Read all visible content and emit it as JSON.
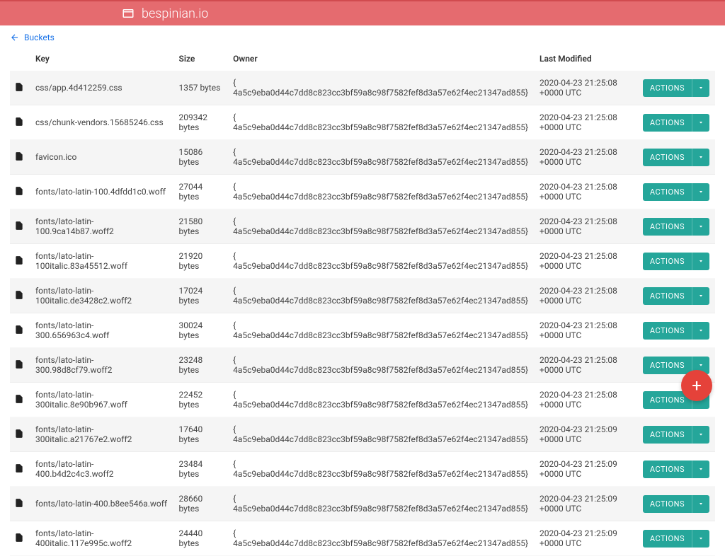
{
  "header": {
    "title": "bespinian.io"
  },
  "breadcrumb": {
    "label": "Buckets"
  },
  "columns": {
    "key": "Key",
    "size": "Size",
    "owner": "Owner",
    "modified": "Last Modified"
  },
  "actions_label": "ACTIONS",
  "rows": [
    {
      "key": "css/app.4d412259.css",
      "size": "1357 bytes",
      "owner": "{ 4a5c9eba0d44c7dd8c823cc3bf59a8c98f7582fef8d3a57e62f4ec21347ad855}",
      "modified": "2020-04-23 21:25:08 +0000 UTC"
    },
    {
      "key": "css/chunk-vendors.15685246.css",
      "size": "209342 bytes",
      "owner": "{ 4a5c9eba0d44c7dd8c823cc3bf59a8c98f7582fef8d3a57e62f4ec21347ad855}",
      "modified": "2020-04-23 21:25:08 +0000 UTC"
    },
    {
      "key": "favicon.ico",
      "size": "15086 bytes",
      "owner": "{ 4a5c9eba0d44c7dd8c823cc3bf59a8c98f7582fef8d3a57e62f4ec21347ad855}",
      "modified": "2020-04-23 21:25:08 +0000 UTC"
    },
    {
      "key": "fonts/lato-latin-100.4dfdd1c0.woff",
      "size": "27044 bytes",
      "owner": "{ 4a5c9eba0d44c7dd8c823cc3bf59a8c98f7582fef8d3a57e62f4ec21347ad855}",
      "modified": "2020-04-23 21:25:08 +0000 UTC"
    },
    {
      "key": "fonts/lato-latin-100.9ca14b87.woff2",
      "size": "21580 bytes",
      "owner": "{ 4a5c9eba0d44c7dd8c823cc3bf59a8c98f7582fef8d3a57e62f4ec21347ad855}",
      "modified": "2020-04-23 21:25:08 +0000 UTC"
    },
    {
      "key": "fonts/lato-latin-100italic.83a45512.woff",
      "size": "21920 bytes",
      "owner": "{ 4a5c9eba0d44c7dd8c823cc3bf59a8c98f7582fef8d3a57e62f4ec21347ad855}",
      "modified": "2020-04-23 21:25:08 +0000 UTC"
    },
    {
      "key": "fonts/lato-latin-100italic.de3428c2.woff2",
      "size": "17024 bytes",
      "owner": "{ 4a5c9eba0d44c7dd8c823cc3bf59a8c98f7582fef8d3a57e62f4ec21347ad855}",
      "modified": "2020-04-23 21:25:08 +0000 UTC"
    },
    {
      "key": "fonts/lato-latin-300.656963c4.woff",
      "size": "30024 bytes",
      "owner": "{ 4a5c9eba0d44c7dd8c823cc3bf59a8c98f7582fef8d3a57e62f4ec21347ad855}",
      "modified": "2020-04-23 21:25:08 +0000 UTC"
    },
    {
      "key": "fonts/lato-latin-300.98d8cf79.woff2",
      "size": "23248 bytes",
      "owner": "{ 4a5c9eba0d44c7dd8c823cc3bf59a8c98f7582fef8d3a57e62f4ec21347ad855}",
      "modified": "2020-04-23 21:25:08 +0000 UTC"
    },
    {
      "key": "fonts/lato-latin-300italic.8e90b967.woff",
      "size": "22452 bytes",
      "owner": "{ 4a5c9eba0d44c7dd8c823cc3bf59a8c98f7582fef8d3a57e62f4ec21347ad855}",
      "modified": "2020-04-23 21:25:08 +0000 UTC"
    },
    {
      "key": "fonts/lato-latin-300italic.a21767e2.woff2",
      "size": "17640 bytes",
      "owner": "{ 4a5c9eba0d44c7dd8c823cc3bf59a8c98f7582fef8d3a57e62f4ec21347ad855}",
      "modified": "2020-04-23 21:25:09 +0000 UTC"
    },
    {
      "key": "fonts/lato-latin-400.b4d2c4c3.woff2",
      "size": "23484 bytes",
      "owner": "{ 4a5c9eba0d44c7dd8c823cc3bf59a8c98f7582fef8d3a57e62f4ec21347ad855}",
      "modified": "2020-04-23 21:25:09 +0000 UTC"
    },
    {
      "key": "fonts/lato-latin-400.b8ee546a.woff",
      "size": "28660 bytes",
      "owner": "{ 4a5c9eba0d44c7dd8c823cc3bf59a8c98f7582fef8d3a57e62f4ec21347ad855}",
      "modified": "2020-04-23 21:25:09 +0000 UTC"
    },
    {
      "key": "fonts/lato-latin-400italic.117e995c.woff2",
      "size": "24440 bytes",
      "owner": "{ 4a5c9eba0d44c7dd8c823cc3bf59a8c98f7582fef8d3a57e62f4ec21347ad855}",
      "modified": "2020-04-23 21:25:09 +0000 UTC"
    }
  ]
}
